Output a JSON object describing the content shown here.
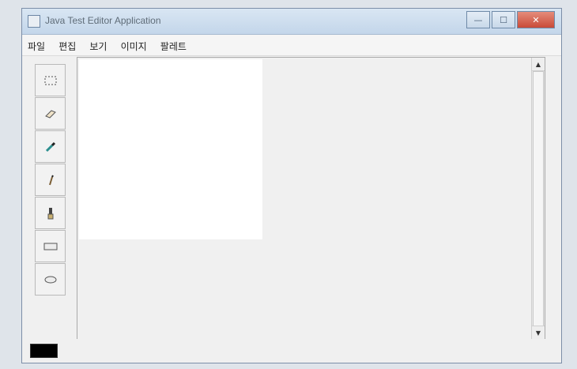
{
  "window": {
    "title": "Java Test Editor Application",
    "controls": {
      "minimize": "—",
      "maximize": "☐",
      "close": "✕"
    }
  },
  "menu": {
    "items": [
      {
        "label": "파일"
      },
      {
        "label": "편집"
      },
      {
        "label": "보기"
      },
      {
        "label": "이미지"
      },
      {
        "label": "팔레트"
      }
    ]
  },
  "tools": [
    {
      "name": "select-tool",
      "icon": "select-rect-icon"
    },
    {
      "name": "eraser-tool",
      "icon": "eraser-icon"
    },
    {
      "name": "eyedropper-tool",
      "icon": "eyedropper-icon"
    },
    {
      "name": "pencil-tool",
      "icon": "pencil-icon"
    },
    {
      "name": "brush-tool",
      "icon": "brush-icon"
    },
    {
      "name": "rectangle-tool",
      "icon": "rectangle-icon"
    },
    {
      "name": "ellipse-tool",
      "icon": "ellipse-icon"
    }
  ],
  "status": {
    "current_color": "#000000"
  },
  "scrollbar": {
    "up": "▲",
    "down": "▼"
  }
}
